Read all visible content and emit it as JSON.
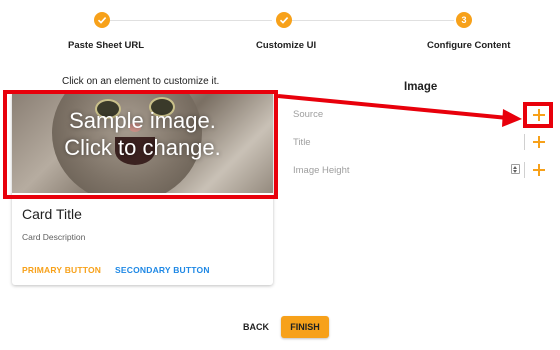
{
  "stepper": {
    "steps": [
      {
        "label": "Paste Sheet URL",
        "state": "done"
      },
      {
        "label": "Customize UI",
        "state": "done"
      },
      {
        "label": "Configure Content",
        "state": "active",
        "number": "3"
      }
    ]
  },
  "hint": "Click on an element to customize it.",
  "card": {
    "image_overlay_line1": "Sample image.",
    "image_overlay_line2": "Click to change.",
    "title": "Card Title",
    "description": "Card Description",
    "primary_button": "PRIMARY BUTTON",
    "secondary_button": "SECONDARY BUTTON"
  },
  "panel": {
    "title": "Image",
    "fields": [
      {
        "label": "Source",
        "icon": "plus-icon"
      },
      {
        "label": "Title",
        "icon": "plus-icon"
      },
      {
        "label": "Image Height",
        "icon": "plus-icon",
        "has_stepper": true
      }
    ]
  },
  "footer": {
    "back_label": "BACK",
    "finish_label": "FINISH"
  },
  "colors": {
    "accent": "#f7a11a",
    "annotation": "#e8000b",
    "primary_button": "#f7a11a",
    "secondary_button": "#1e88e5"
  }
}
